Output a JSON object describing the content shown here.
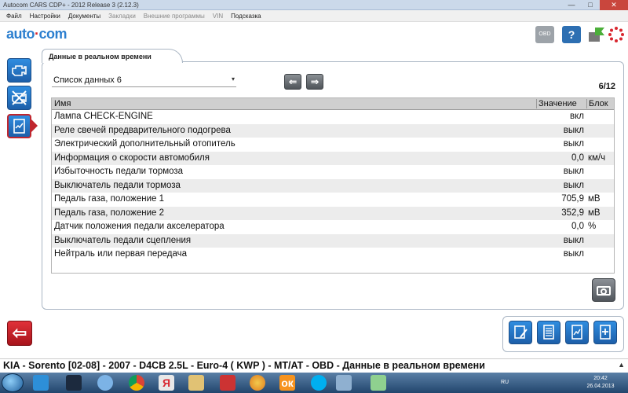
{
  "window": {
    "title": "Autocom CARS CDP+ - 2012 Release 3 (2.12.3)",
    "controls": {
      "minimize": "—",
      "maximize": "□",
      "close": "✕"
    }
  },
  "menu": {
    "items": [
      {
        "label": "Файл",
        "enabled": true
      },
      {
        "label": "Настройки",
        "enabled": true
      },
      {
        "label": "Документы",
        "enabled": true
      },
      {
        "label": "Закладки",
        "enabled": false
      },
      {
        "label": "Внешние программы",
        "enabled": false
      },
      {
        "label": "VIN",
        "enabled": false
      },
      {
        "label": "Подсказка",
        "enabled": true
      }
    ]
  },
  "header": {
    "logo_left": "auto",
    "logo_right": "com",
    "obd_label": "OBD",
    "help_glyph": "?",
    "icons": [
      "obd-icon",
      "help-icon",
      "flag-icon",
      "spinner-icon"
    ]
  },
  "sidebar": {
    "items": [
      {
        "icon": "engine-icon",
        "active": false
      },
      {
        "icon": "no-engine-icon",
        "active": false
      },
      {
        "icon": "live-data-icon",
        "active": true
      }
    ],
    "back_glyph": "⇦"
  },
  "panel": {
    "tab_label": "Данные в реальном времени",
    "list_select": {
      "value": "Список данных 6",
      "caret": "▾"
    },
    "nav": {
      "prev": "⇐",
      "next": "⇒"
    },
    "page_counter": "6/12",
    "columns": {
      "name": "Имя",
      "value": "Значение",
      "unit": "Блок"
    },
    "rows": [
      {
        "name": "Лампа CHECK-ENGINE",
        "value": "вкл",
        "unit": ""
      },
      {
        "name": "Реле свечей предварительного подогрева",
        "value": "выкл",
        "unit": ""
      },
      {
        "name": "Электрический дополнительный отопитель",
        "value": "выкл",
        "unit": ""
      },
      {
        "name": "Информация о скорости автомобиля",
        "value": "0,0",
        "unit": "км/ч"
      },
      {
        "name": "Избыточность педали тормоза",
        "value": "выкл",
        "unit": ""
      },
      {
        "name": "Выключатель педали тормоза",
        "value": "выкл",
        "unit": ""
      },
      {
        "name": "Педаль газа, положение 1",
        "value": "705,9",
        "unit": "мВ"
      },
      {
        "name": "Педаль газа, положение 2",
        "value": "352,9",
        "unit": "мВ"
      },
      {
        "name": "Датчик положения педали акселератора",
        "value": "0,0",
        "unit": "%"
      },
      {
        "name": "Выключатель педали сцепления",
        "value": "выкл",
        "unit": ""
      },
      {
        "name": "Нейтраль или первая передача",
        "value": "выкл",
        "unit": ""
      }
    ]
  },
  "bottom_tools": [
    "edit-list-icon",
    "list-icon",
    "graph-icon",
    "print-icon"
  ],
  "status_bar": {
    "text": "KIA - Sorento [02-08] - 2007 - D4CB 2.5L - Euro-4 ( KWP ) - MT/AT - OBD - Данные в реальном времени",
    "caret": "▲"
  },
  "taskbar": {
    "language": "RU",
    "time": "20:42",
    "date": "26.04.2013",
    "apps": [
      "ie-icon",
      "media-icon",
      "itunes-icon",
      "chrome-icon",
      "yandex-icon",
      "explorer-icon",
      "cars-icon",
      "paint-icon",
      "odnoklassniki-icon",
      "skype-icon",
      "car-icon",
      "notes-icon"
    ]
  }
}
